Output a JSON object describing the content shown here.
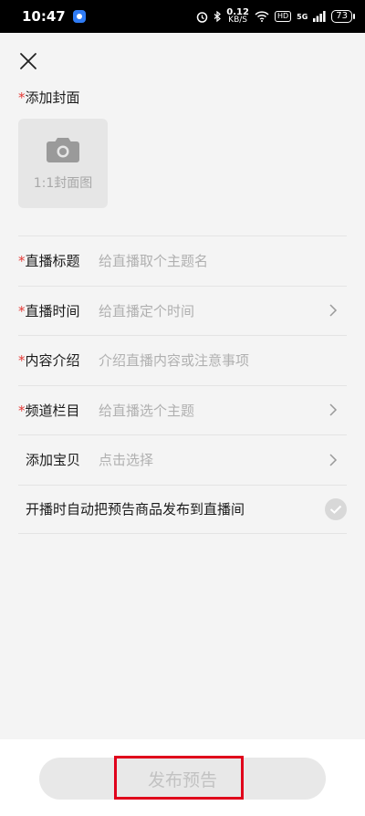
{
  "status_bar": {
    "time": "10:47",
    "net_speed": "0.12",
    "net_unit": "KB/S",
    "hd": "HD",
    "network": "5G",
    "battery": "73"
  },
  "cover": {
    "required_mark": "*",
    "label": "添加封面",
    "placeholder": "1:1封面图"
  },
  "form": {
    "title": {
      "required_mark": "*",
      "label": "直播标题",
      "placeholder": "给直播取个主题名"
    },
    "time": {
      "required_mark": "*",
      "label": "直播时间",
      "placeholder": "给直播定个时间"
    },
    "intro": {
      "required_mark": "*",
      "label": "内容介绍",
      "placeholder": "介绍直播内容或注意事项"
    },
    "channel": {
      "required_mark": "*",
      "label": "频道栏目",
      "placeholder": "给直播选个主题"
    },
    "goods": {
      "label": "添加宝贝",
      "placeholder": "点击选择"
    },
    "auto_publish": {
      "label": "开播时自动把预告商品发布到直播间",
      "checked": false
    }
  },
  "footer": {
    "publish_label": "发布预告"
  }
}
